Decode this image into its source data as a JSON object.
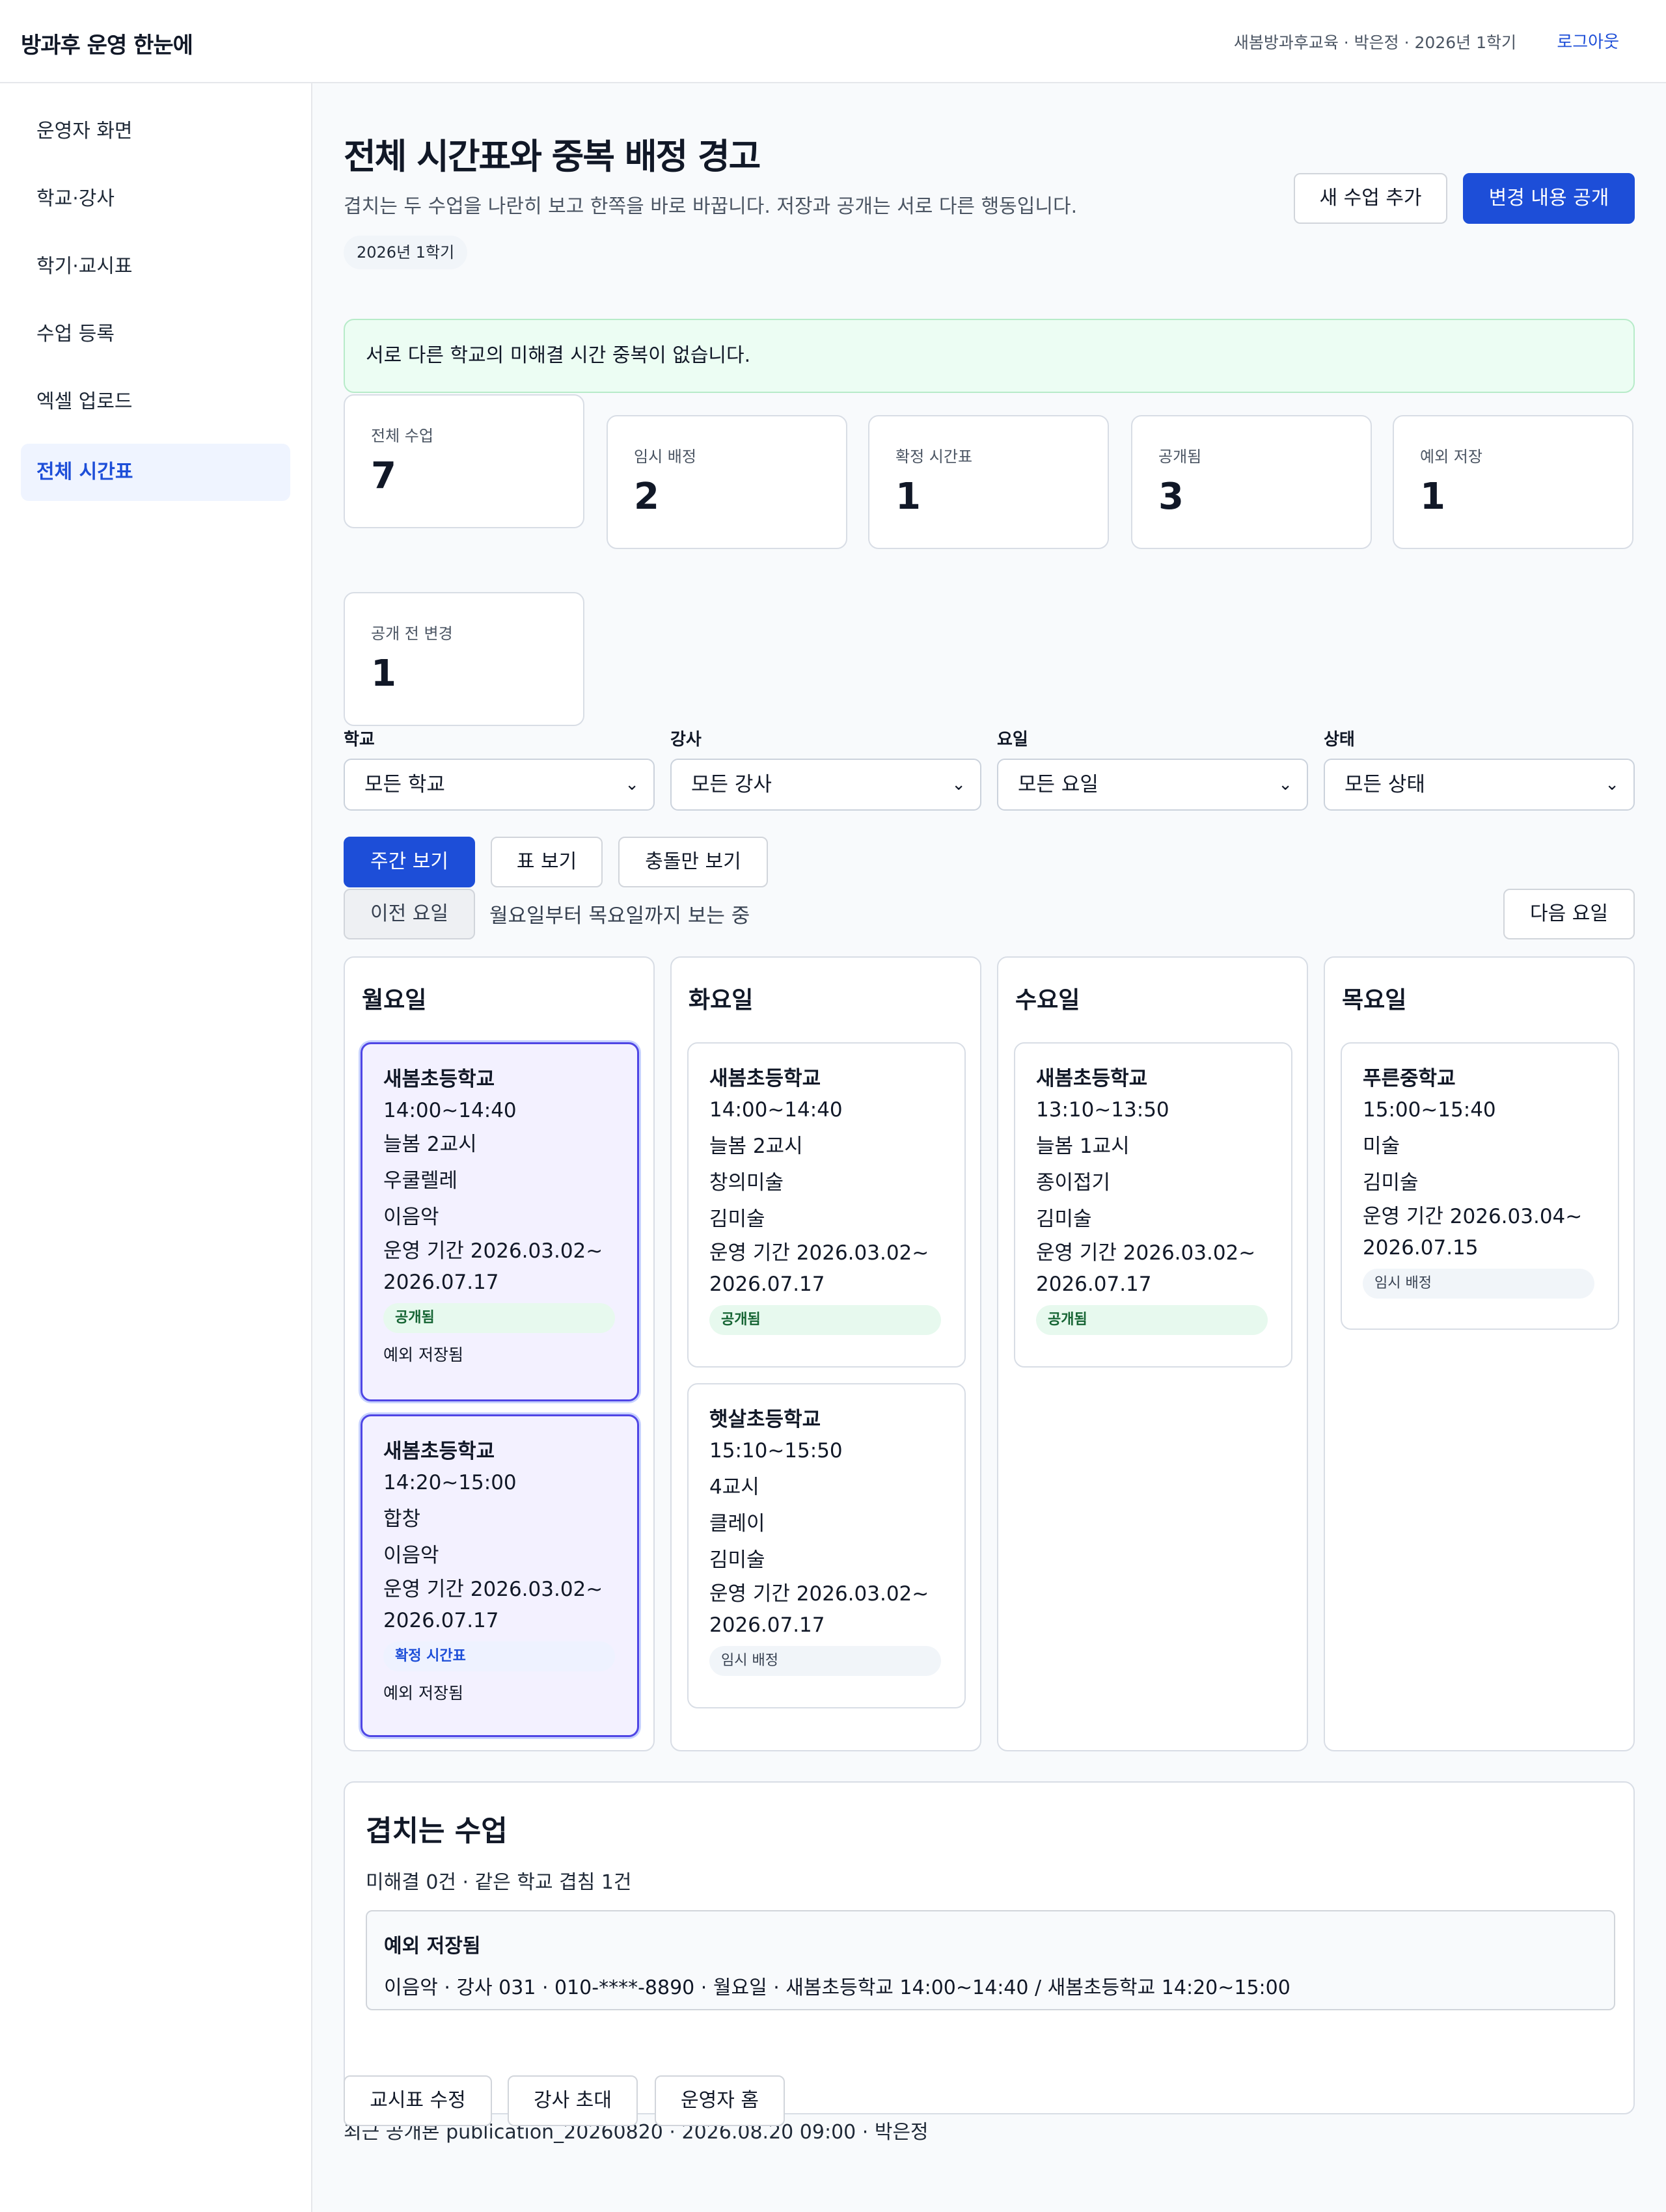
{
  "header": {
    "brand": "방과후 운영 한눈에",
    "meta": "새봄방과후교육 · 박은정 · 2026년 1학기",
    "logout": "로그아웃"
  },
  "sidebar": {
    "items": [
      {
        "label": "운영자 화면"
      },
      {
        "label": "학교·강사"
      },
      {
        "label": "학기·교시표"
      },
      {
        "label": "수업 등록"
      },
      {
        "label": "엑셀 업로드"
      },
      {
        "label": "전체 시간표",
        "active": true
      }
    ]
  },
  "page": {
    "title": "전체 시간표와 중복 배정 경고",
    "subtitle": "겹치는 두 수업을 나란히 보고 한쪽을 바로 바꿉니다. 저장과 공개는 서로 다른 행동입니다.",
    "term_badge": "2026년 1학기",
    "add_button": "새 수업 추가",
    "publish_button": "변경 내용 공개"
  },
  "alert": "서로 다른 학교의 미해결 시간 중복이 없습니다.",
  "stats": [
    {
      "label": "전체 수업",
      "value": "7"
    },
    {
      "label": "임시 배정",
      "value": "2"
    },
    {
      "label": "확정 시간표",
      "value": "1"
    },
    {
      "label": "공개됨",
      "value": "3"
    },
    {
      "label": "예외 저장",
      "value": "1"
    },
    {
      "label": "공개 전 변경",
      "value": "1"
    }
  ],
  "filters": {
    "school": {
      "label": "학교",
      "value": "모든 학교"
    },
    "teacher": {
      "label": "강사",
      "value": "모든 강사"
    },
    "day": {
      "label": "요일",
      "value": "모든 요일"
    },
    "status": {
      "label": "상태",
      "value": "모든 상태"
    }
  },
  "view_tabs": {
    "weekly": "주간 보기",
    "table": "표 보기",
    "conflicts": "충돌만 보기"
  },
  "day_nav": {
    "prev": "이전 요일",
    "status": "월요일부터 목요일까지 보는 중",
    "next": "다음 요일"
  },
  "days": [
    {
      "title": "월요일",
      "cards": [
        {
          "school": "새봄초등학교",
          "time": "14:00~14:40",
          "period": "늘봄 2교시",
          "subject": "우쿨렐레",
          "teacher": "이음악",
          "term1": "운영 기간 2026.03.02~",
          "term2": "2026.07.17",
          "status": "공개됨",
          "note": "예외 저장됨"
        },
        {
          "school": "새봄초등학교",
          "time": "14:20~15:00",
          "period": "합창",
          "subject": "이음악",
          "teacher": "",
          "term1": "운영 기간 2026.03.02~",
          "term2": "2026.07.17",
          "status": "확정 시간표",
          "note": "예외 저장됨"
        }
      ]
    },
    {
      "title": "화요일",
      "cards": [
        {
          "school": "새봄초등학교",
          "time": "14:00~14:40",
          "period": "늘봄 2교시",
          "subject": "창의미술",
          "teacher": "김미술",
          "term1": "운영 기간 2026.03.02~",
          "term2": "2026.07.17",
          "status": "공개됨"
        },
        {
          "school": "햇살초등학교",
          "time": "15:10~15:50",
          "period": "4교시",
          "subject": "클레이",
          "teacher": "김미술",
          "term1": "운영 기간 2026.03.02~",
          "term2": "2026.07.17",
          "status": "임시 배정"
        }
      ]
    },
    {
      "title": "수요일",
      "cards": [
        {
          "school": "새봄초등학교",
          "time": "13:10~13:50",
          "period": "늘봄 1교시",
          "subject": "종이접기",
          "teacher": "김미술",
          "term1": "운영 기간 2026.03.02~",
          "term2": "2026.07.17",
          "status": "공개됨"
        }
      ]
    },
    {
      "title": "목요일",
      "cards": [
        {
          "school": "푸른중학교",
          "time": "15:00~15:40",
          "period": "미술",
          "subject": "김미술",
          "term1": "운영 기간 2026.03.04~",
          "term2": "2026.07.15",
          "status": "임시 배정"
        }
      ]
    }
  ],
  "overlap": {
    "title": "겹치는 수업",
    "summary": "미해결 0건 · 같은 학교 겹침 1건",
    "item_title": "예외 저장됨",
    "item_detail": "이음악 · 강사 031 · 010-****-8890 · 월요일 · 새봄초등학교 14:00~14:40 / 새봄초등학교 14:20~15:00"
  },
  "publish_note": "최근 공개본 publication_20260820 · 2026.08.20 09:00 · 박은정",
  "footer_buttons": {
    "edit_periods": "교시표 수정",
    "invite_teacher": "강사 초대",
    "operator_home": "운영자 홈"
  }
}
